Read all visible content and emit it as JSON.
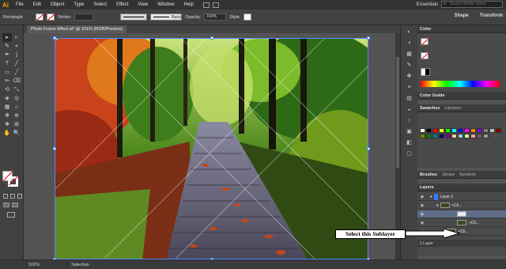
{
  "app": {
    "logo": "Ai"
  },
  "menu": {
    "items": [
      "File",
      "Edit",
      "Object",
      "Type",
      "Select",
      "Effect",
      "View",
      "Window",
      "Help"
    ],
    "workspace": "Essentials",
    "search_placeholder": "Search Adobe Stock"
  },
  "control_bar": {
    "tool_label": "Rectangle",
    "stroke_label": "Stroke:",
    "brush_label": "Basic",
    "opacity_label": "Opacity:",
    "opacity_value": "100%",
    "style_label": "Style:",
    "shape_label": "Shape",
    "transform_label": "Transform"
  },
  "document": {
    "tab_title": "Photo Frame Effect.ai* @ 101% (RGB/Preview)"
  },
  "toolbar": {
    "tools": [
      "▸",
      "▹",
      "✎",
      "⌖",
      "✒",
      "⟆",
      "T",
      "╱",
      "▭",
      "╱",
      "✏",
      "⌫",
      "⟲",
      "⤡",
      "◈",
      "◎",
      "▦",
      "⌂",
      "✥",
      "⊕",
      "❖",
      "⊞",
      "✋",
      "🔍"
    ]
  },
  "panels": {
    "color": {
      "tab": "Color"
    },
    "color_guide": {
      "tab": "Color Guide"
    },
    "swatches": {
      "tab": "Swatches",
      "tab2": "Libraries"
    },
    "brushes": {
      "tab": "Brushes",
      "tab2": "Stroke",
      "tab3": "Symbols"
    },
    "layers": {
      "tab": "Layers",
      "rows": [
        {
          "name": "Layer 1"
        },
        {
          "name": "<Cli..."
        },
        {
          "name": ""
        },
        {
          "name": "<Cli..."
        },
        {
          "name": "<Cli..."
        }
      ],
      "footer": "1 Layer"
    }
  },
  "status": {
    "zoom": "101%",
    "tool": "Selection"
  },
  "annotation": {
    "text": "Select this Sublayer"
  },
  "colors": {
    "accent": "#ff9a00",
    "selection": "#4f8bff",
    "ui_dark": "#323232"
  }
}
